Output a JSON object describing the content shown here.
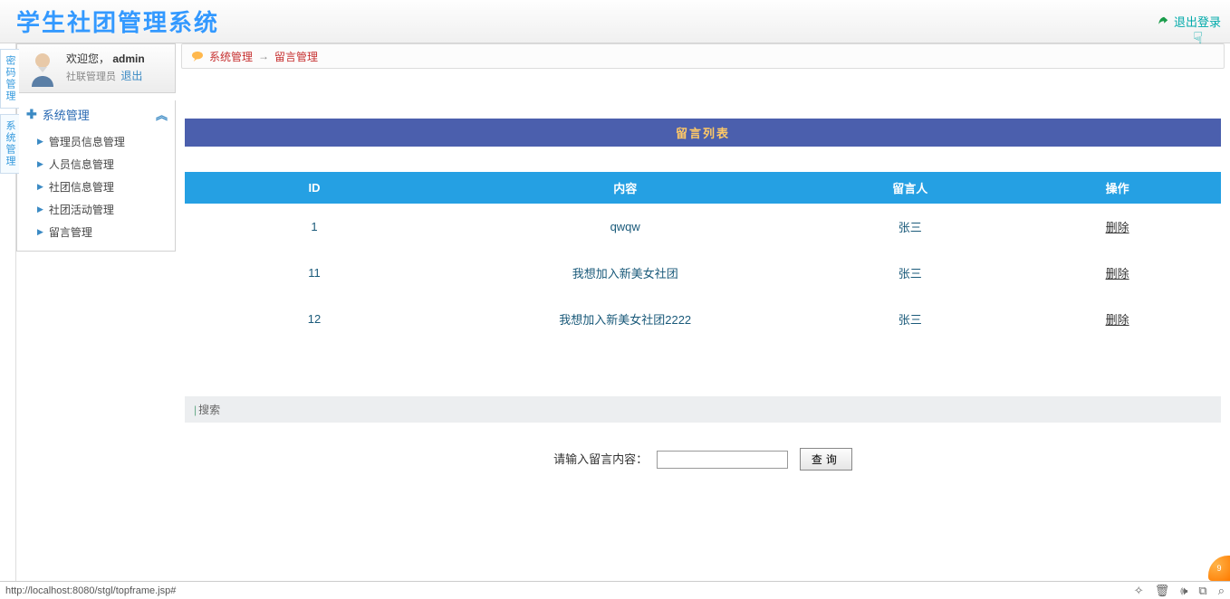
{
  "header": {
    "title": "学生社团管理系统",
    "logout": "退出登录"
  },
  "user": {
    "welcome_prefix": "欢迎您，",
    "username": "admin",
    "role": "社联管理员",
    "logout": "退出"
  },
  "sideTabs": {
    "tab1": "密码管理",
    "tab2": "系统管理"
  },
  "nav": {
    "header": "系统管理",
    "items": [
      {
        "label": "管理员信息管理"
      },
      {
        "label": "人员信息管理"
      },
      {
        "label": "社团信息管理"
      },
      {
        "label": "社团活动管理"
      },
      {
        "label": "留言管理"
      }
    ]
  },
  "breadcrumb": {
    "item1": "系统管理",
    "sep": "→",
    "item2": "留言管理"
  },
  "table": {
    "title": "留言列表",
    "headers": {
      "id": "ID",
      "content": "内容",
      "author": "留言人",
      "action": "操作"
    },
    "deleteLabel": "删除",
    "rows": [
      {
        "id": "1",
        "content": "qwqw",
        "author": "张三"
      },
      {
        "id": "11",
        "content": "我想加入新美女社团",
        "author": "张三"
      },
      {
        "id": "12",
        "content": "我想加入新美女社团2222",
        "author": "张三"
      }
    ]
  },
  "search": {
    "header": "搜索",
    "label": "请输入留言内容：",
    "value": "",
    "button": "查询"
  },
  "statusbar": {
    "url": "http://localhost:8080/stgl/topframe.jsp#"
  }
}
